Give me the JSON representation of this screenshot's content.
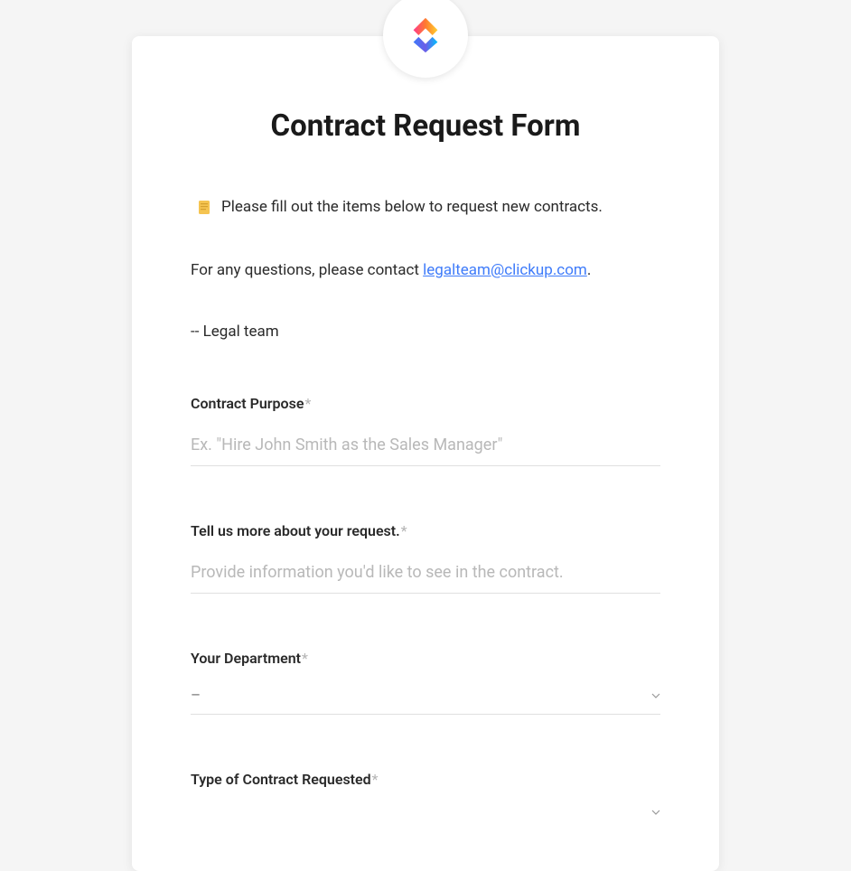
{
  "form": {
    "title": "Contract Request Form",
    "intro": {
      "line1": "Please fill out the items below to request new contracts.",
      "line2_prefix": "For any questions, please contact ",
      "contact_email": "legalteam@clickup.com",
      "line2_suffix": ".",
      "signature": "-- Legal team"
    },
    "fields": {
      "purpose": {
        "label": "Contract Purpose",
        "placeholder": "Ex. \"Hire John Smith as the Sales Manager\""
      },
      "details": {
        "label": "Tell us more about your request.",
        "placeholder": "Provide information you'd like to see in the contract."
      },
      "department": {
        "label": "Your Department",
        "value": "–"
      },
      "contract_type": {
        "label": "Type of Contract Requested",
        "value": ""
      }
    },
    "required_mark": "*"
  }
}
